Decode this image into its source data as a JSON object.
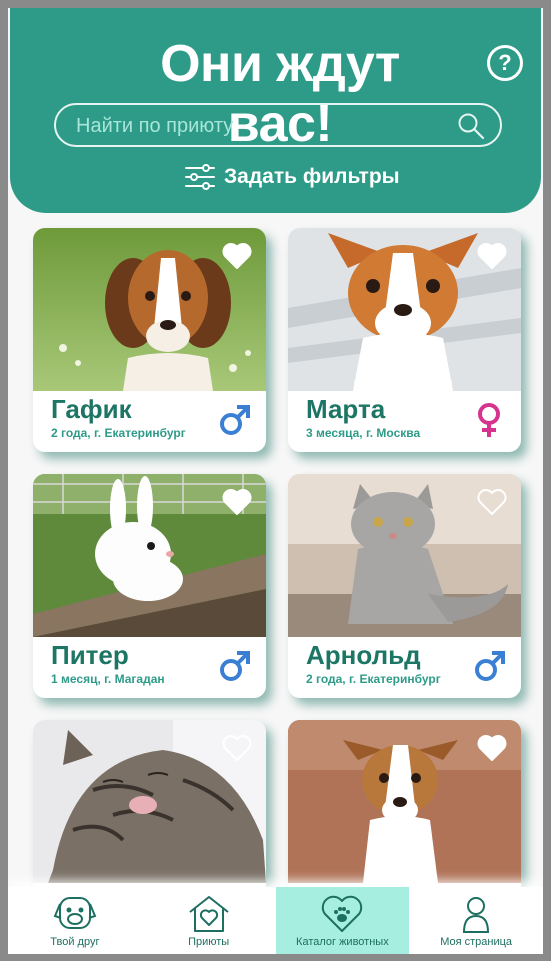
{
  "header": {
    "title": "Они ждут вас!",
    "help_symbol": "?",
    "search_placeholder": "Найти по приюту",
    "filters_label": "Задать фильтры"
  },
  "colors": {
    "primary": "#2e9b88",
    "active_tab": "#a6eee0",
    "male": "#3b7fd4",
    "female": "#d6338f"
  },
  "pets": [
    {
      "name": "Гафик",
      "meta": "2 года, г. Екатеринбург",
      "gender": "male",
      "favorite": true
    },
    {
      "name": "Марта",
      "meta": "3 месяца, г. Москва",
      "gender": "female",
      "favorite": true
    },
    {
      "name": "Питер",
      "meta": "1 месяц, г. Магадан",
      "gender": "male",
      "favorite": true
    },
    {
      "name": "Арнольд",
      "meta": "2 года, г. Екатеринбург",
      "gender": "male",
      "favorite": false
    },
    {
      "name": "",
      "meta": "",
      "gender": "",
      "favorite": false
    },
    {
      "name": "",
      "meta": "",
      "gender": "",
      "favorite": true
    }
  ],
  "tabs": [
    {
      "label": "Твой друг",
      "icon": "dog-face-icon"
    },
    {
      "label": "Приюты",
      "icon": "house-heart-icon"
    },
    {
      "label": "Каталог животных",
      "icon": "heart-paw-icon",
      "active": true
    },
    {
      "label": "Моя страница",
      "icon": "user-icon"
    }
  ]
}
